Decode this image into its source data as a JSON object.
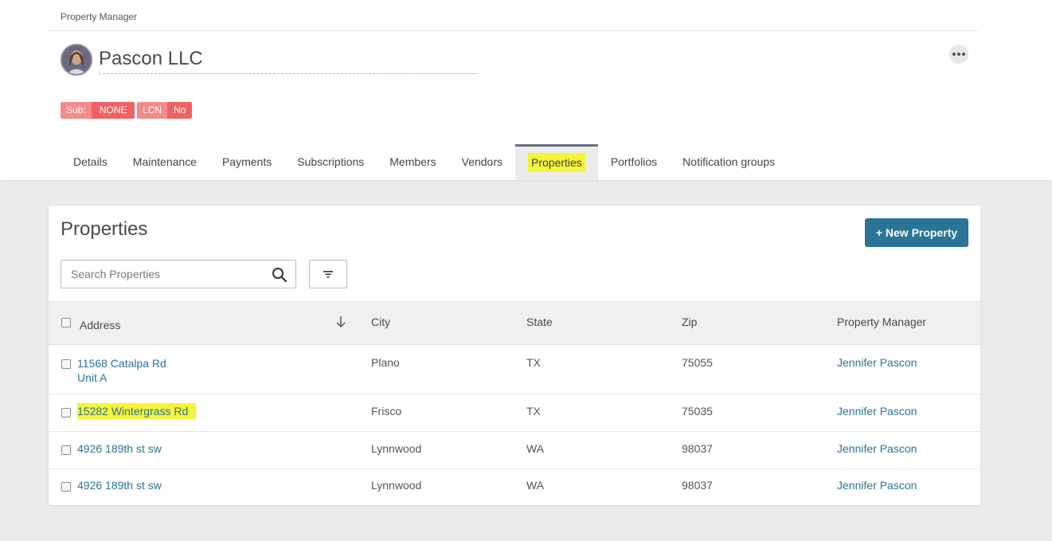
{
  "breadcrumb": "Property Manager",
  "company": {
    "name": "Pascon LLC"
  },
  "badges": [
    {
      "key": "Sub:",
      "value": "NONE"
    },
    {
      "key": "LCN",
      "value": "No"
    }
  ],
  "tabs": [
    {
      "label": "Details"
    },
    {
      "label": "Maintenance"
    },
    {
      "label": "Payments"
    },
    {
      "label": "Subscriptions"
    },
    {
      "label": "Members"
    },
    {
      "label": "Vendors"
    },
    {
      "label": "Properties",
      "active": true
    },
    {
      "label": "Portfolios"
    },
    {
      "label": "Notification groups"
    }
  ],
  "properties": {
    "title": "Properties",
    "new_button": "+ New Property",
    "search_placeholder": "Search Properties",
    "columns": [
      "Address",
      "City",
      "State",
      "Zip",
      "Property Manager"
    ],
    "rows": [
      {
        "address_line1": "11568 Catalpa Rd",
        "address_line2": "Unit A",
        "city": "Plano",
        "state": "TX",
        "zip": "75055",
        "manager": "Jennifer Pascon"
      },
      {
        "address_line1": "15282 Wintergrass Rd",
        "address_line2": "",
        "city": "Frisco",
        "state": "TX",
        "zip": "75035",
        "manager": "Jennifer Pascon",
        "highlighted": true
      },
      {
        "address_line1": "4926 189th st sw",
        "address_line2": "",
        "city": "Lynnwood",
        "state": "WA",
        "zip": "98037",
        "manager": "Jennifer Pascon"
      },
      {
        "address_line1": "4926 189th st sw",
        "address_line2": "",
        "city": "Lynnwood",
        "state": "WA",
        "zip": "98037",
        "manager": "Jennifer Pascon"
      }
    ]
  },
  "colors": {
    "accent": "#2a7496",
    "highlight": "#f5f33a",
    "badge_key": "#f38b8b",
    "badge_value": "#f06262"
  }
}
